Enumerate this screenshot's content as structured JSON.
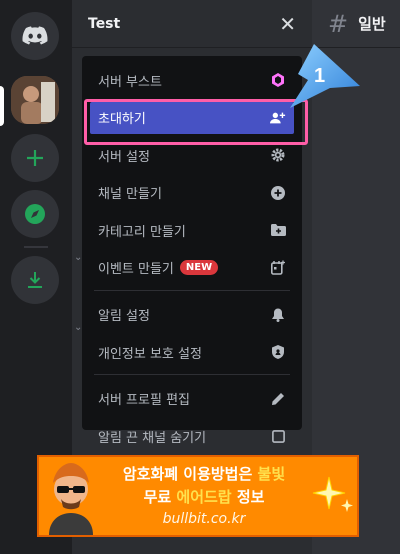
{
  "server": {
    "name": "Test"
  },
  "channel": {
    "name": "일반"
  },
  "menu": {
    "items": [
      {
        "label": "서버 부스트",
        "icon": "boost-icon"
      },
      {
        "label": "초대하기",
        "icon": "add-person-icon"
      },
      {
        "label": "서버 설정",
        "icon": "gear-icon"
      },
      {
        "label": "채널 만들기",
        "icon": "plus-circle-icon"
      },
      {
        "label": "카테고리 만들기",
        "icon": "folder-plus-icon"
      },
      {
        "label": "이벤트 만들기",
        "icon": "calendar-plus-icon",
        "badge": "NEW"
      },
      {
        "label": "알림 설정",
        "icon": "bell-icon"
      },
      {
        "label": "개인정보 보호 설정",
        "icon": "shield-icon"
      },
      {
        "label": "서버 프로필 편집",
        "icon": "pencil-icon"
      },
      {
        "label": "알림 끈 채널 숨기기",
        "icon": "checkbox-icon"
      }
    ]
  },
  "callout": {
    "number": "1"
  },
  "ad": {
    "line1_a": "암호화폐 이용방법은 ",
    "line1_b": "불빛",
    "line2_a": "무료 ",
    "line2_b": "에어드랍",
    "line2_c": " 정보",
    "url": "bullbit.co.kr"
  },
  "colors": {
    "accent": "#4752c4",
    "highlight_border": "#ff5ea8",
    "green": "#23a55a",
    "banner": "#ff8a00"
  }
}
